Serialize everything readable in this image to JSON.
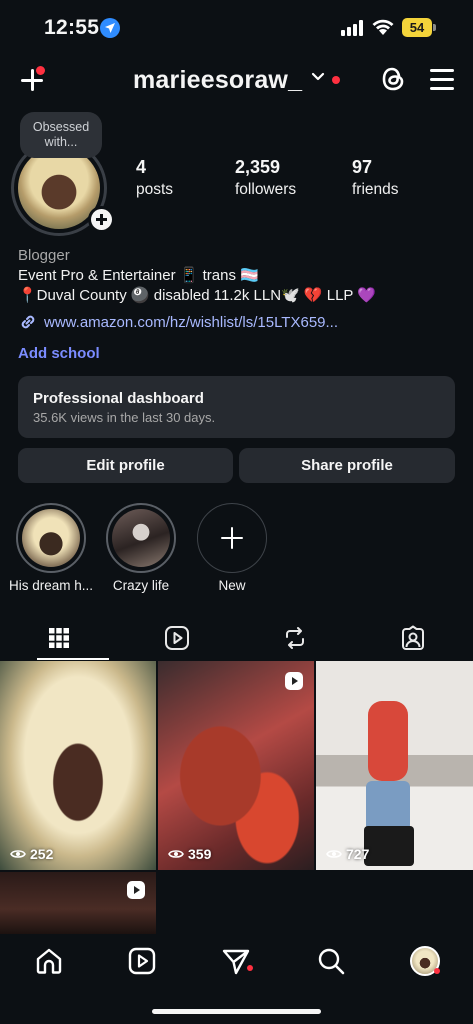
{
  "status_bar": {
    "time": "12:55",
    "battery": "54"
  },
  "header": {
    "username": "marieesoraw_"
  },
  "profile": {
    "note": "Obsessed with...",
    "stats": [
      {
        "value": "4",
        "label": "posts"
      },
      {
        "value": "2,359",
        "label": "followers"
      },
      {
        "value": "97",
        "label": "friends"
      }
    ],
    "category": "Blogger",
    "bio_line1": "Event Pro & Entertainer 📱 trans 🏳️‍⚧️",
    "bio_line2": "📍Duval County 🎱 disabled 11.2k LLN🕊️ 💔 LLP 💜",
    "link": "www.amazon.com/hz/wishlist/ls/15LTX659...",
    "add_school": "Add school"
  },
  "dashboard": {
    "title": "Professional dashboard",
    "subtitle": "35.6K views in the last 30 days."
  },
  "buttons": {
    "edit": "Edit profile",
    "share": "Share profile"
  },
  "highlights": [
    {
      "label": "His dream h..."
    },
    {
      "label": "Crazy life"
    },
    {
      "label": "New"
    }
  ],
  "tabs": [
    "grid-icon",
    "reels-icon",
    "reposts-icon",
    "tagged-icon"
  ],
  "posts": [
    {
      "views": "252",
      "type": "photo"
    },
    {
      "views": "359",
      "type": "reel"
    },
    {
      "views": "727",
      "type": "photo"
    },
    {
      "views": "",
      "type": "reel"
    }
  ],
  "bottom_nav": [
    "home-icon",
    "reels-icon",
    "messages-icon",
    "search-icon",
    "profile-avatar"
  ],
  "colors": {
    "background": "#0c1014",
    "card": "#262a30",
    "link": "#a9b9ff",
    "accent_blue": "#7b8cff",
    "notification_red": "#ff3040",
    "battery": "#f4d43a"
  }
}
